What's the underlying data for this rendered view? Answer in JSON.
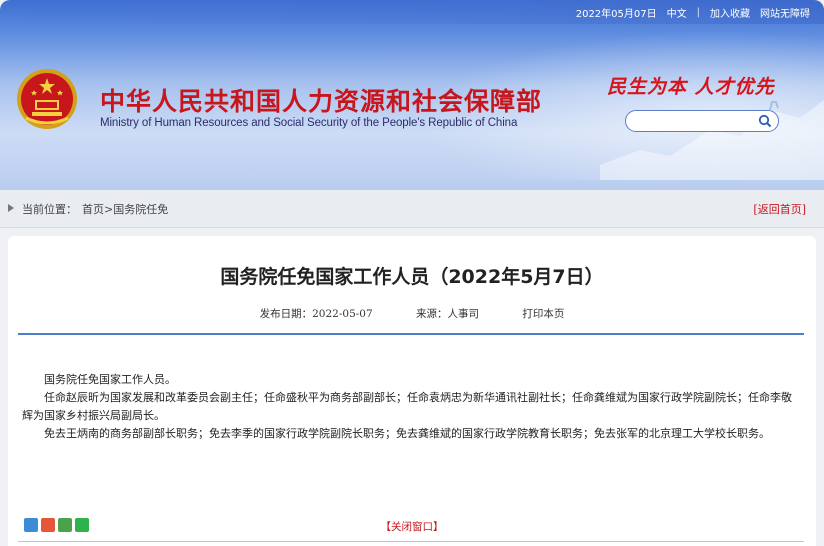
{
  "topbar": {
    "date": "2022年05月07日",
    "language": "中文",
    "separator": "|",
    "favorite": "加入收藏",
    "accessibility": "网站无障碍"
  },
  "header": {
    "title_cn": "中华人民共和国人力资源和社会保障部",
    "title_en": "Ministry of Human Resources and Social Security of the People's Republic of China",
    "slogan": "民生为本 人才优先",
    "search": {
      "placeholder": "",
      "value": ""
    }
  },
  "breadcrumb": {
    "label": "当前位置：",
    "path": "首页>国务院任免",
    "back": "[返回首页]"
  },
  "article": {
    "title": "国务院任免国家工作人员（2022年5月7日）",
    "publish_date": "发布日期：2022-05-07",
    "source": "来源：人事司",
    "print": "打印本页",
    "paragraphs": [
      "国务院任免国家工作人员。",
      "任命赵辰昕为国家发展和改革委员会副主任；任命盛秋平为商务部副部长；任命袁炳忠为新华通讯社副社长；任命龚维斌为国家行政学院副院长；任命李敬辉为国家乡村振兴局副局长。",
      "免去王炳南的商务部副部长职务；免去李季的国家行政学院副院长职务；免去龚维斌的国家行政学院教育长职务；免去张军的北京理工大学校长职务。"
    ],
    "close": "【关闭窗口】"
  },
  "colors": {
    "accent_red": "#c8161d",
    "rule_blue": "#4a7ec9"
  }
}
